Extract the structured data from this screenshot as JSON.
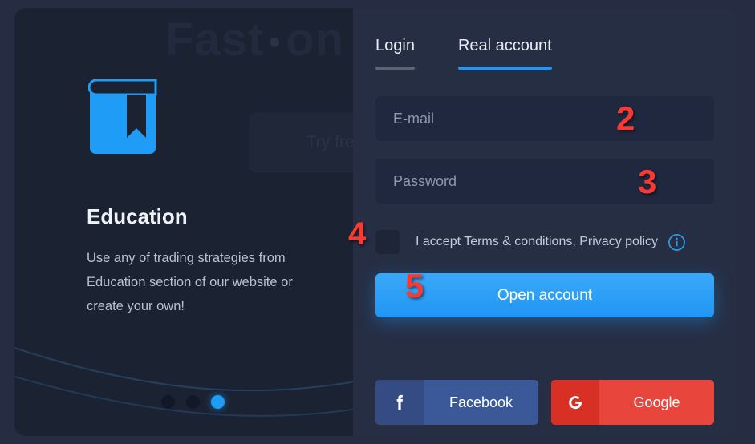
{
  "promo": {
    "hero_title_left": "Fast",
    "hero_title_dot": "•",
    "hero_title_right": "on",
    "try_free_label": "Try free",
    "icon": "book-icon",
    "heading": "Education",
    "body": "Use any of trading strategies from Education section of our website or create your own!",
    "carousel": {
      "total": 3,
      "active_index": 3
    }
  },
  "auth": {
    "tabs": [
      {
        "label": "Login",
        "active": false
      },
      {
        "label": "Real account",
        "active": true
      }
    ],
    "email": {
      "placeholder": "E-mail",
      "value": ""
    },
    "password": {
      "placeholder": "Password",
      "value": ""
    },
    "terms": {
      "label": "I accept Terms & conditions, Privacy policy",
      "checked": false,
      "info_icon": "info-circle-icon"
    },
    "submit_label": "Open account",
    "social": [
      {
        "name": "Facebook",
        "label": "Facebook",
        "icon": "facebook-icon",
        "color": "#3b5998"
      },
      {
        "name": "Google",
        "label": "Google",
        "icon": "google-icon",
        "color": "#e8453c"
      }
    ]
  },
  "annotations": {
    "email_step": "2",
    "password_step": "3",
    "terms_step": "4",
    "submit_step": "5",
    "color": "#f93a32"
  },
  "colors": {
    "page_bg": "#262d43",
    "card_bg": "#1b2232",
    "panel_bg": "#262e44",
    "field_bg": "#202840",
    "accent": "#2196f3"
  }
}
